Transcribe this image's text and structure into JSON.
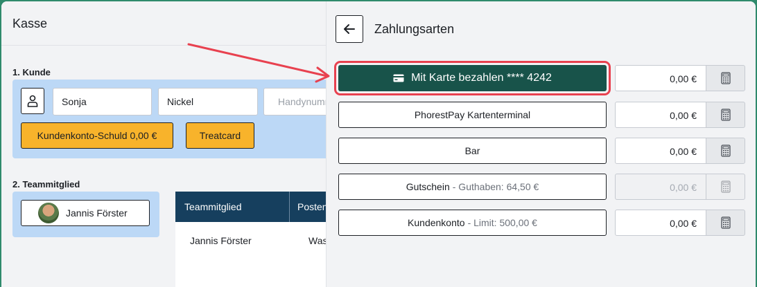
{
  "left": {
    "title": "Kasse",
    "section_customer": "1. Kunde",
    "first_name": "Sonja",
    "last_name": "Nickel",
    "phone_placeholder": "Handynummer",
    "customer_debt_button": "Kundenkonto-Schuld 0,00 €",
    "treatcard_button": "Treatcard",
    "section_team": "2. Teammitglied",
    "team_member_button": "Jannis Förster",
    "table": {
      "headers": [
        "Teammitglied",
        "Posten"
      ],
      "rows": [
        [
          "Jannis Förster",
          "Was"
        ]
      ]
    }
  },
  "right": {
    "title": "Zahlungsarten",
    "methods": [
      {
        "label": "Mit Karte bezahlen **** 4242",
        "sub": "",
        "amount": "0,00 €",
        "disabled": false,
        "primary": true
      },
      {
        "label": "PhorestPay Kartenterminal",
        "sub": "",
        "amount": "0,00 €",
        "disabled": false,
        "primary": false
      },
      {
        "label": "Bar",
        "sub": "",
        "amount": "0,00 €",
        "disabled": false,
        "primary": false
      },
      {
        "label": "Gutschein",
        "sub": "- Guthaben: 64,50 €",
        "amount": "0,00 €",
        "disabled": true,
        "primary": false
      },
      {
        "label": "Kundenkonto",
        "sub": "- Limit: 500,00 €",
        "amount": "0,00 €",
        "disabled": false,
        "primary": false
      }
    ]
  },
  "colors": {
    "primary_green": "#18534a",
    "highlight_red": "#e8414f",
    "orange": "#f8b32b",
    "light_blue": "#bcd8f6",
    "table_header": "#163f5e"
  },
  "icons": [
    "person-icon",
    "phone-icon",
    "back-arrow-icon",
    "credit-card-icon",
    "calculator-icon"
  ]
}
